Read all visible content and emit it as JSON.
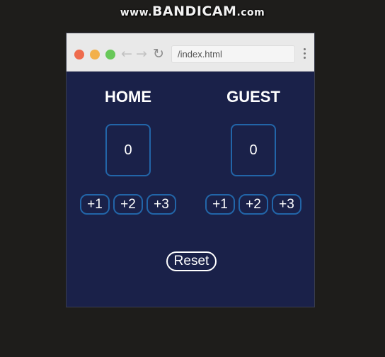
{
  "watermark": {
    "prefix": "www.",
    "brand": "BANDICAM",
    "suffix": ".com"
  },
  "browser": {
    "url": "/index.html",
    "icons": {
      "back": "arrow-left-icon",
      "forward": "arrow-right-icon",
      "reload": "reload-icon",
      "menu": "kebab-menu-icon"
    },
    "traffic_lights": [
      "#ee6b4d",
      "#f3b04b",
      "#68c859"
    ]
  },
  "scoreboard": {
    "home": {
      "title": "HOME",
      "score": "0",
      "buttons": [
        "+1",
        "+2",
        "+3"
      ]
    },
    "guest": {
      "title": "GUEST",
      "score": "0",
      "buttons": [
        "+1",
        "+2",
        "+3"
      ]
    },
    "reset_label": "Reset"
  },
  "colors": {
    "page_bg": "#1a2149",
    "accent_border": "#2265a8",
    "text": "#ffffff"
  }
}
